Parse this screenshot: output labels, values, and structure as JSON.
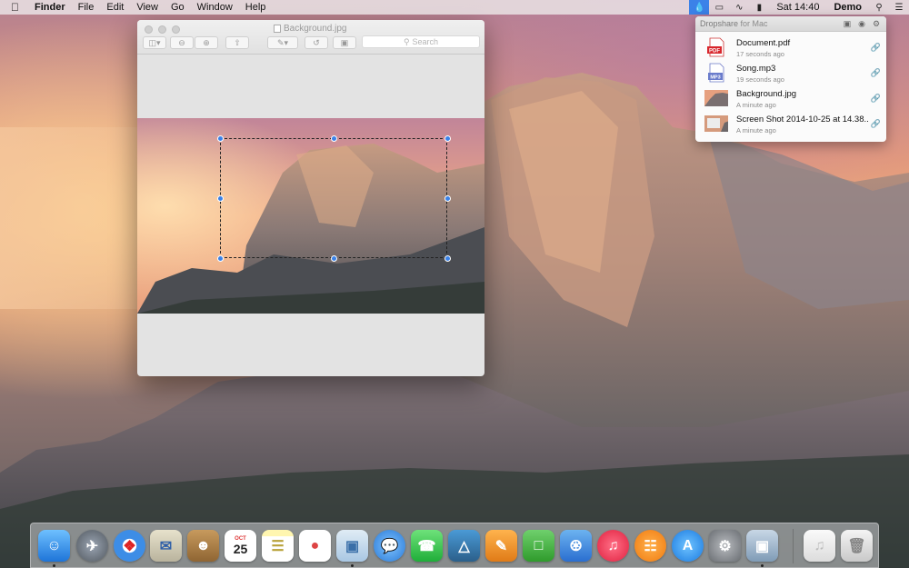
{
  "menubar": {
    "apple_icon": "apple-logo",
    "app_name": "Finder",
    "menus": [
      "File",
      "Edit",
      "View",
      "Go",
      "Window",
      "Help"
    ],
    "status_icons": [
      "dropshare-icon",
      "airplay-icon",
      "wifi-icon",
      "battery-icon"
    ],
    "clock": "Sat 14:40",
    "user": "Demo",
    "extra_icons": [
      "spotlight-icon",
      "notification-center-icon"
    ]
  },
  "preview_window": {
    "title": "Background.jpg",
    "search_placeholder": "Search",
    "toolbar_icons": [
      "sidebar-icon",
      "zoom-out-icon",
      "zoom-in-icon",
      "share-icon",
      "markup-pen-icon",
      "rotate-icon",
      "toolbox-icon"
    ]
  },
  "dropshare": {
    "title": "Dropshare",
    "subtitle": "for Mac",
    "accent": "#3b82e8",
    "items": [
      {
        "name": "Document.pdf",
        "time": "17 seconds ago",
        "thumb": "pdf-file-icon",
        "badge": "PDF"
      },
      {
        "name": "Song.mp3",
        "time": "19 seconds ago",
        "thumb": "mp3-file-icon",
        "badge": "MP3"
      },
      {
        "name": "Background.jpg",
        "time": "A minute ago",
        "thumb": "image-thumbnail"
      },
      {
        "name": "Screen Shot 2014-10-25 at 14.38....",
        "time": "A minute ago",
        "thumb": "screenshot-thumbnail"
      }
    ]
  },
  "dock": {
    "calendar_month": "OCT",
    "calendar_day": "25",
    "apps": [
      "Finder",
      "Launchpad",
      "Safari",
      "Mail",
      "Contacts",
      "Calendar",
      "Notes",
      "Reminders",
      "Preview",
      "Messages",
      "FaceTime",
      "iPhoto",
      "Pages",
      "Numbers",
      "Keynote",
      "iTunes",
      "iBooks",
      "App Store",
      "System Preferences",
      "Preview",
      "Downloads",
      "Trash"
    ]
  }
}
